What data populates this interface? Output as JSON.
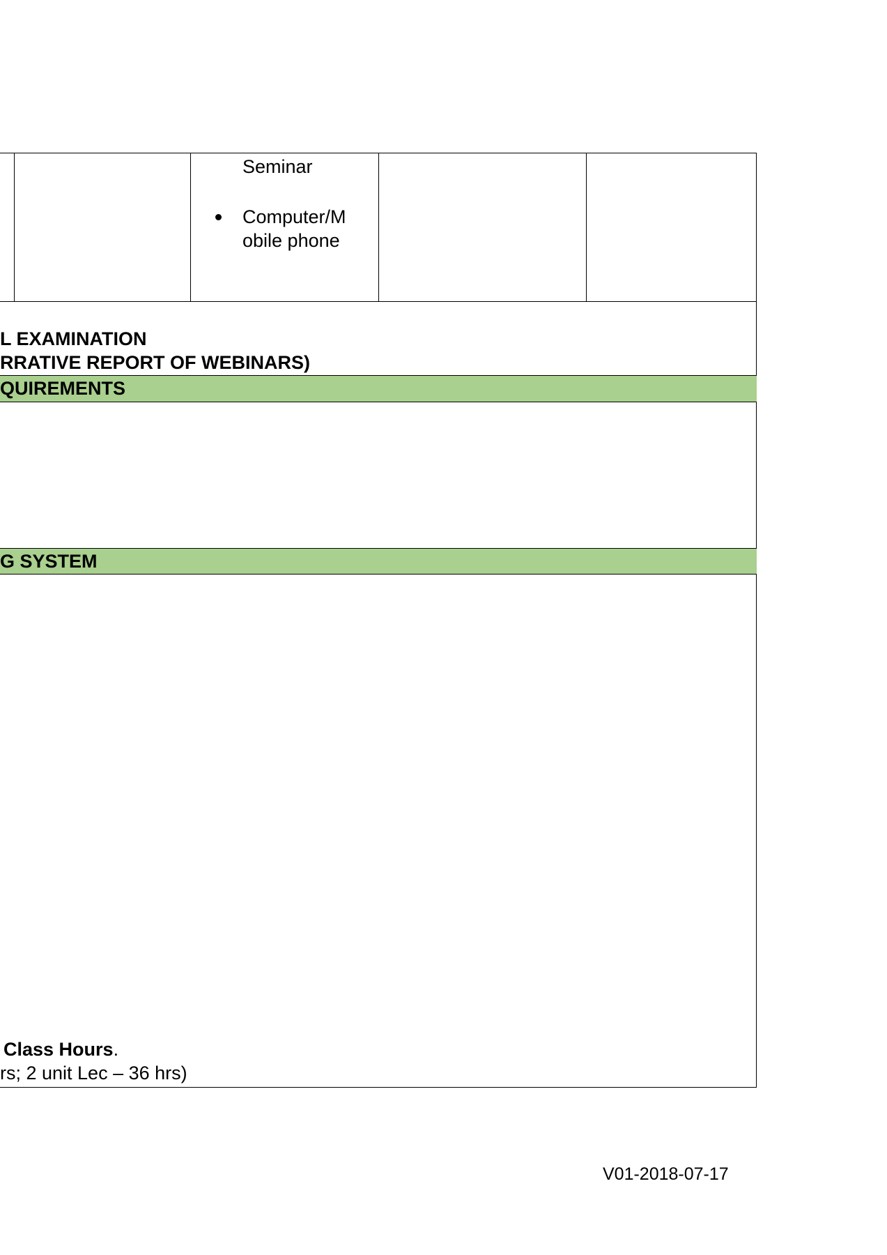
{
  "colors": {
    "section_header_bg": "#a9d08e",
    "border": "#000000",
    "text": "#000000"
  },
  "equipment_row": {
    "cell_text_top": "Seminar",
    "bullet_item_line1": "Computer/M",
    "bullet_item_line2": "obile phone"
  },
  "exam_block": {
    "line1": "L EXAMINATION",
    "line2": "RRATIVE REPORT OF WEBINARS)"
  },
  "sections": {
    "requirements_header": "QUIREMENTS",
    "grading_header": "G SYSTEM"
  },
  "class_hours": {
    "bold_text": "Class Hours",
    "bold_suffix": ".",
    "line2": "rs; 2 unit Lec – 36 hrs)"
  },
  "footer": {
    "version": "V01-2018-07-17"
  }
}
